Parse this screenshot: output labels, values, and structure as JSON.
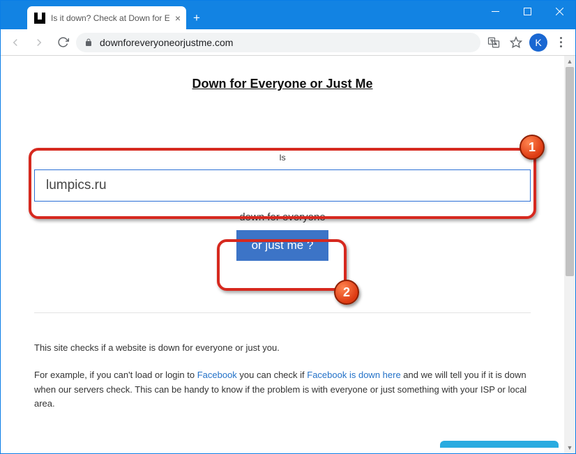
{
  "window": {
    "tab_title": "Is it down? Check at Down for Ev",
    "url": "downforeveryoneorjustme.com",
    "avatar_letter": "K"
  },
  "page": {
    "title": "Down for Everyone or Just Me",
    "prompt": "Is",
    "input_value": "lumpics.ru",
    "status_text": "down for everyone",
    "button_label": "or just me ?",
    "info1": "This site checks if a website is down for everyone or just you.",
    "info2_pre": "For example, if you can't load or login to ",
    "info2_link1": "Facebook",
    "info2_mid": " you can check if ",
    "info2_link2": "Facebook is down here",
    "info2_post": " and we will tell you if it is down when our servers check. This can be handy to know if the problem is with everyone or just something with your ISP or local area."
  },
  "annotations": {
    "badge1": "1",
    "badge2": "2"
  }
}
